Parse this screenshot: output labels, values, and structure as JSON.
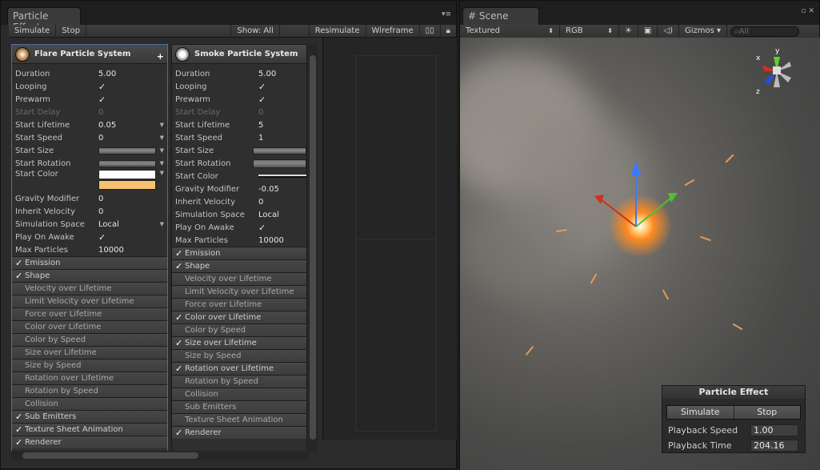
{
  "left": {
    "tab": "Particle Effect",
    "toolbar": {
      "simulate": "Simulate",
      "stop": "Stop",
      "show": "Show: All",
      "resimulate": "Resimulate",
      "wireframe": "Wireframe"
    },
    "flare": {
      "title": "Flare Particle System",
      "props": [
        {
          "label": "Duration",
          "value": "5.00"
        },
        {
          "label": "Looping",
          "value": "✓"
        },
        {
          "label": "Prewarm",
          "value": "✓"
        },
        {
          "label": "Start Delay",
          "value": "0"
        },
        {
          "label": "Start Lifetime",
          "value": "0.05"
        },
        {
          "label": "Start Speed",
          "value": "0"
        },
        {
          "label": "Start Size",
          "value": ""
        },
        {
          "label": "Start Rotation",
          "value": ""
        },
        {
          "label": "Start Color",
          "value": ""
        },
        {
          "label": "Gravity Modifier",
          "value": "0"
        },
        {
          "label": "Inherit Velocity",
          "value": "0"
        },
        {
          "label": "Simulation Space",
          "value": "Local"
        },
        {
          "label": "Play On Awake",
          "value": "✓"
        },
        {
          "label": "Max Particles",
          "value": "10000"
        }
      ],
      "modules": [
        {
          "label": "Emission",
          "on": true
        },
        {
          "label": "Shape",
          "on": true
        },
        {
          "label": "Velocity over Lifetime",
          "on": false
        },
        {
          "label": "Limit Velocity over Lifetime",
          "on": false
        },
        {
          "label": "Force over Lifetime",
          "on": false
        },
        {
          "label": "Color over Lifetime",
          "on": false
        },
        {
          "label": "Color by Speed",
          "on": false
        },
        {
          "label": "Size over Lifetime",
          "on": false
        },
        {
          "label": "Size by Speed",
          "on": false
        },
        {
          "label": "Rotation over Lifetime",
          "on": false
        },
        {
          "label": "Rotation by Speed",
          "on": false
        },
        {
          "label": "Collision",
          "on": false
        },
        {
          "label": "Sub Emitters",
          "on": true
        },
        {
          "label": "Texture Sheet Animation",
          "on": true
        },
        {
          "label": "Renderer",
          "on": true
        }
      ]
    },
    "smoke": {
      "title": "Smoke Particle System",
      "props": [
        {
          "label": "Duration",
          "value": "5.00"
        },
        {
          "label": "Looping",
          "value": "✓"
        },
        {
          "label": "Prewarm",
          "value": "✓"
        },
        {
          "label": "Start Delay",
          "value": "0"
        },
        {
          "label": "Start Lifetime",
          "value": "5"
        },
        {
          "label": "Start Speed",
          "value": "1"
        },
        {
          "label": "Start Size",
          "value": ""
        },
        {
          "label": "Start Rotation",
          "value": ""
        },
        {
          "label": "Start Color",
          "value": ""
        },
        {
          "label": "Gravity Modifier",
          "value": "-0.05"
        },
        {
          "label": "Inherit Velocity",
          "value": "0"
        },
        {
          "label": "Simulation Space",
          "value": "Local"
        },
        {
          "label": "Play On Awake",
          "value": "✓"
        },
        {
          "label": "Max Particles",
          "value": "10000"
        }
      ],
      "modules": [
        {
          "label": "Emission",
          "on": true
        },
        {
          "label": "Shape",
          "on": true
        },
        {
          "label": "Velocity over Lifetime",
          "on": false
        },
        {
          "label": "Limit Velocity over Lifetime",
          "on": false
        },
        {
          "label": "Force over Lifetime",
          "on": false
        },
        {
          "label": "Color over Lifetime",
          "on": true
        },
        {
          "label": "Color by Speed",
          "on": false
        },
        {
          "label": "Size over Lifetime",
          "on": true
        },
        {
          "label": "Size by Speed",
          "on": false
        },
        {
          "label": "Rotation over Lifetime",
          "on": true
        },
        {
          "label": "Rotation by Speed",
          "on": false
        },
        {
          "label": "Collision",
          "on": false
        },
        {
          "label": "Sub Emitters",
          "on": false
        },
        {
          "label": "Texture Sheet Animation",
          "on": false
        },
        {
          "label": "Renderer",
          "on": true
        }
      ]
    }
  },
  "scene": {
    "tab": "Scene",
    "render_mode": "Textured",
    "channel": "RGB",
    "gizmos": "Gizmos",
    "search_placeholder": "All",
    "axes": {
      "x": "x",
      "y": "y",
      "z": "z"
    }
  },
  "overlay": {
    "title": "Particle Effect",
    "simulate": "Simulate",
    "stop": "Stop",
    "playback_speed_label": "Playback Speed",
    "playback_speed": "1.00",
    "playback_time_label": "Playback Time",
    "playback_time": "204.16"
  },
  "colors": {
    "accent": "#4a6fa8",
    "spark": "#ff8a20"
  }
}
